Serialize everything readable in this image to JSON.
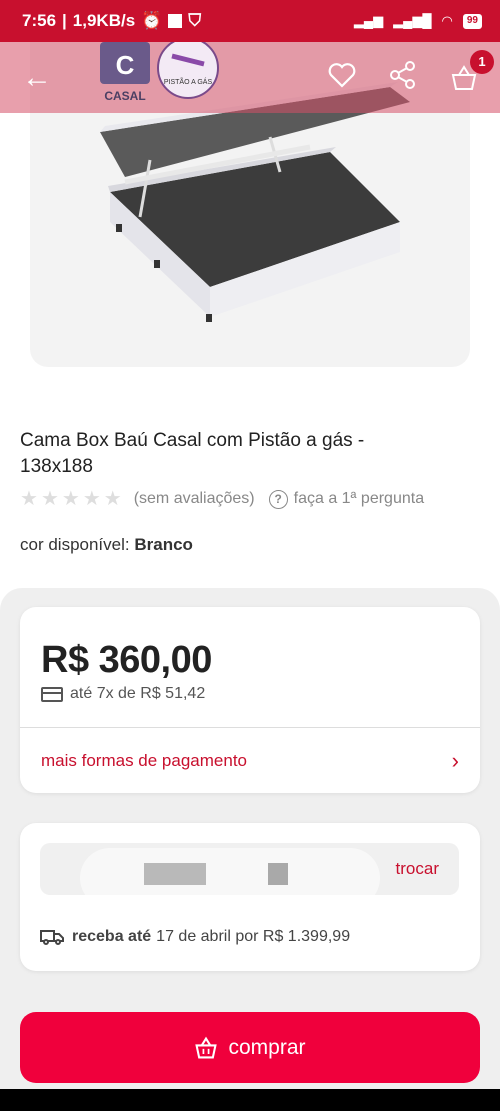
{
  "status_bar": {
    "time": "7:56",
    "speed": "1,9KB/s",
    "battery": "99"
  },
  "app_bar": {
    "cart_count": "1",
    "logo_letter": "C",
    "logo_text": "CASAL",
    "logo_badge": "PISTÃO A GÁS"
  },
  "product": {
    "title": "Cama Box Baú Casal com Pistão a gás - 138x188",
    "rating_text": "(sem avaliações)",
    "question_text": "faça a 1ª pergunta",
    "color_label": "cor disponível:",
    "color_value": "Branco",
    "stars": 0
  },
  "price_card": {
    "price": "R$ 360,00",
    "installments": "até 7x de R$ 51,42",
    "more_payment": "mais formas de pagamento"
  },
  "shipping_card": {
    "change_label": "trocar",
    "deliver_bold": "receba até",
    "deliver_rest": "17 de abril por R$ 1.399,99"
  },
  "buy_button": {
    "label": "comprar"
  },
  "colors": {
    "brand_red": "#c8102e",
    "buy_red": "#f0003c"
  }
}
